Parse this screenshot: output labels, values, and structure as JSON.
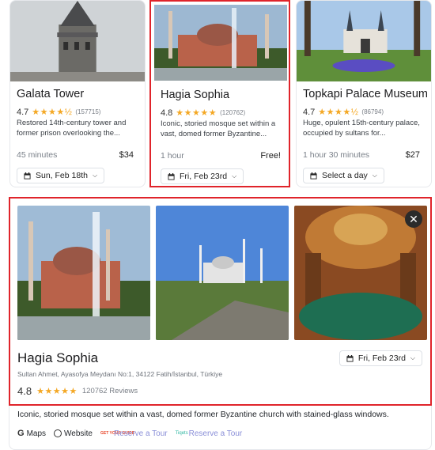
{
  "cards": [
    {
      "title": "Galata Tower",
      "rating": "4.7",
      "stars": "★★★★½",
      "reviews": "(157715)",
      "description": "Restored 14th-century tower and former prison overlooking the...",
      "duration": "45 minutes",
      "price": "$34",
      "date": "Sun, Feb 18th"
    },
    {
      "title": "Hagia Sophia",
      "rating": "4.8",
      "stars": "★★★★★",
      "reviews": "(120762)",
      "description": "Iconic, storied mosque set within a vast, domed former Byzantine...",
      "duration": "1 hour",
      "price": "Free!",
      "date": "Fri, Feb 23rd"
    },
    {
      "title": "Topkapi Palace Museum",
      "rating": "4.7",
      "stars": "★★★★½",
      "reviews": "(86794)",
      "description": "Huge, opulent 15th-century palace, occupied by sultans for...",
      "duration": "1 hour 30 minutes",
      "price": "$27",
      "date": "Select a day"
    }
  ],
  "detail": {
    "title": "Hagia Sophia",
    "address": "Sultan Ahmet, Ayasofya Meydanı No:1, 34122 Fatih/İstanbul, Türkiye",
    "rating": "4.8",
    "stars": "★★★★★",
    "reviews": "120762 Reviews",
    "date": "Fri, Feb 23rd",
    "close": "✕",
    "description": "Iconic, storied mosque set within a vast, domed former Byzantine church with stained-glass windows.",
    "links": {
      "maps": "Maps",
      "website": "Website",
      "tour1": "Reserve a Tour",
      "tour2": "Reserve a Tour",
      "gyg_logo": "GET YOUR GUIDE",
      "tiqets_logo": "Tiqets"
    }
  },
  "icons": {
    "calendar": "calendar-icon",
    "chevron": "chevron-down-icon"
  },
  "colors": {
    "highlight": "#e0242b",
    "star": "#f4a825",
    "tour_link": "#8a8fd8"
  }
}
